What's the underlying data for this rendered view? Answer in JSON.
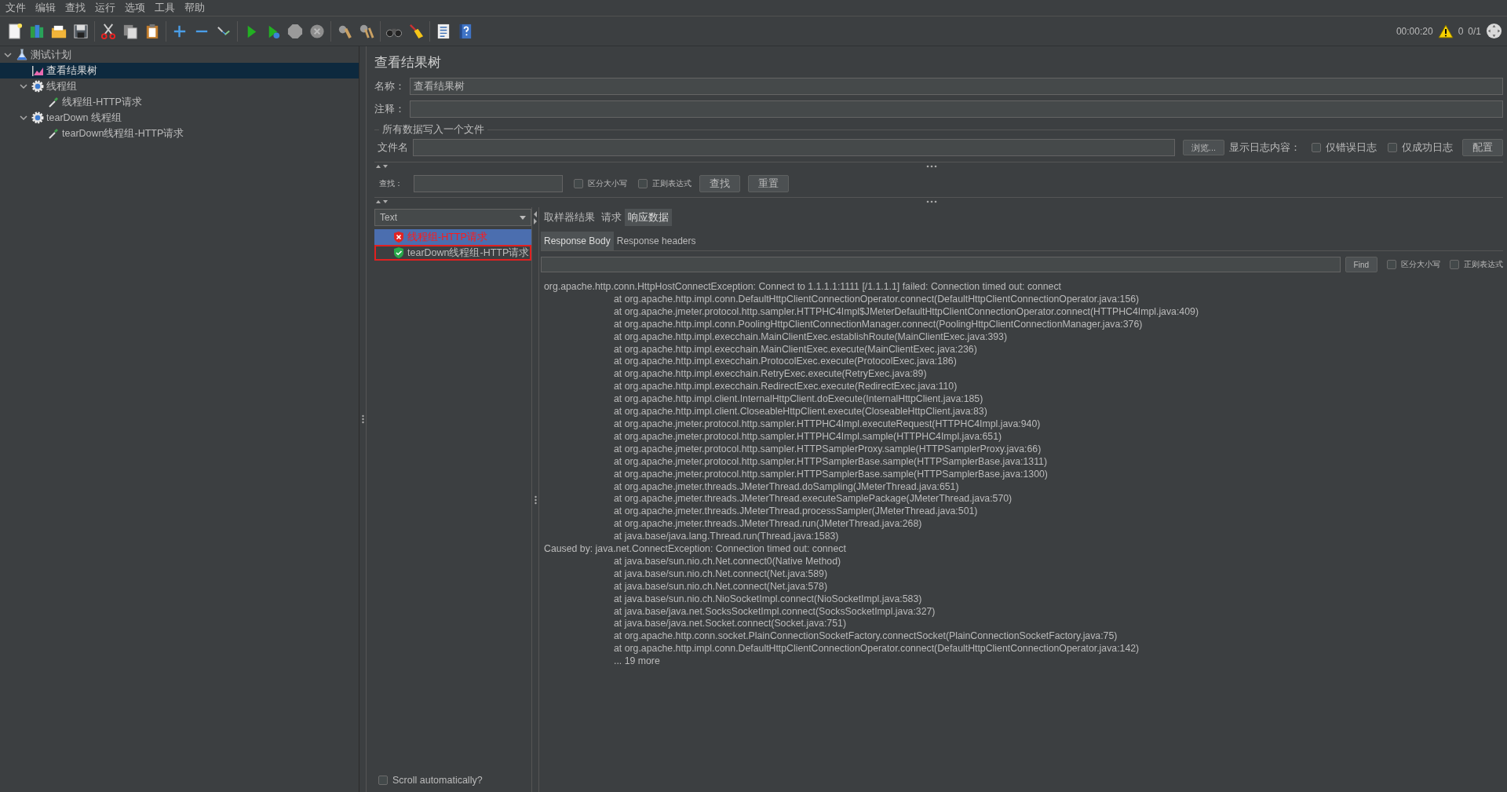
{
  "menu": [
    "文件",
    "编辑",
    "查找",
    "运行",
    "选项",
    "工具",
    "帮助"
  ],
  "status": {
    "elapsed": "00:00:20",
    "errors": "0",
    "threads": "0/1"
  },
  "tree": [
    {
      "label": "测试计划",
      "kind": "plan",
      "selected": false,
      "expanded": true,
      "children": [
        {
          "label": "查看结果树",
          "kind": "listener",
          "selected": true
        },
        {
          "label": "线程组",
          "kind": "thread_group",
          "selected": false,
          "expanded": true,
          "children": [
            {
              "label": "线程组-HTTP请求",
              "kind": "sampler",
              "selected": false
            }
          ]
        },
        {
          "label": "tearDown 线程组",
          "kind": "thread_group",
          "selected": false,
          "expanded": true,
          "children": [
            {
              "label": "tearDown线程组-HTTP请求",
              "kind": "sampler",
              "selected": false
            }
          ]
        }
      ]
    }
  ],
  "panel": {
    "title": "查看结果树",
    "name_label": "名称：",
    "name_value": "查看结果树",
    "comment_label": "注释：",
    "file_section": "所有数据写入一个文件",
    "filename_label": "文件名",
    "browse_button": "浏览...",
    "log_label": "显示日志内容：",
    "log_options": [
      {
        "label": "仅错误日志",
        "checked": false
      },
      {
        "label": "仅成功日志",
        "checked": false
      }
    ],
    "configure_button": "配置"
  },
  "search": {
    "label": "查找：",
    "options": [
      {
        "label": "区分大小写",
        "checked": false
      },
      {
        "label": "正则表达式",
        "checked": false
      }
    ],
    "find_button": "查找",
    "reset_button": "重置"
  },
  "results": {
    "renderer": "Text",
    "items": [
      {
        "label": "线程组-HTTP请求",
        "kind": "error",
        "selected": true,
        "focused": false
      },
      {
        "label": "tearDown线程组-HTTP请求",
        "kind": "success",
        "selected": false,
        "focused": true
      }
    ]
  },
  "tabs": [
    {
      "label": "取样器结果",
      "selected": false
    },
    {
      "label": "请求",
      "selected": false
    },
    {
      "label": "响应数据",
      "selected": true
    }
  ],
  "subtabs": [
    {
      "label": "Response Body",
      "selected": true
    },
    {
      "label": "Response headers",
      "selected": false
    }
  ],
  "body_search": {
    "button": "Find",
    "options": [
      {
        "label": "区分大小写",
        "checked": false
      },
      {
        "label": "正则表达式",
        "checked": false
      }
    ]
  },
  "response_lines": [
    {
      "kind": "head",
      "text": "org.apache.http.conn.HttpHostConnectException: Connect to 1.1.1.1:1111 [/1.1.1.1] failed: Connection timed out: connect"
    },
    {
      "kind": "frame",
      "text": "at org.apache.http.impl.conn.DefaultHttpClientConnectionOperator.connect(DefaultHttpClientConnectionOperator.java:156)"
    },
    {
      "kind": "frame",
      "text": "at org.apache.jmeter.protocol.http.sampler.HTTPHC4Impl$JMeterDefaultHttpClientConnectionOperator.connect(HTTPHC4Impl.java:409)"
    },
    {
      "kind": "frame",
      "text": "at org.apache.http.impl.conn.PoolingHttpClientConnectionManager.connect(PoolingHttpClientConnectionManager.java:376)"
    },
    {
      "kind": "frame",
      "text": "at org.apache.http.impl.execchain.MainClientExec.establishRoute(MainClientExec.java:393)"
    },
    {
      "kind": "frame",
      "text": "at org.apache.http.impl.execchain.MainClientExec.execute(MainClientExec.java:236)"
    },
    {
      "kind": "frame",
      "text": "at org.apache.http.impl.execchain.ProtocolExec.execute(ProtocolExec.java:186)"
    },
    {
      "kind": "frame",
      "text": "at org.apache.http.impl.execchain.RetryExec.execute(RetryExec.java:89)"
    },
    {
      "kind": "frame",
      "text": "at org.apache.http.impl.execchain.RedirectExec.execute(RedirectExec.java:110)"
    },
    {
      "kind": "frame",
      "text": "at org.apache.http.impl.client.InternalHttpClient.doExecute(InternalHttpClient.java:185)"
    },
    {
      "kind": "frame",
      "text": "at org.apache.http.impl.client.CloseableHttpClient.execute(CloseableHttpClient.java:83)"
    },
    {
      "kind": "frame",
      "text": "at org.apache.jmeter.protocol.http.sampler.HTTPHC4Impl.executeRequest(HTTPHC4Impl.java:940)"
    },
    {
      "kind": "frame",
      "text": "at org.apache.jmeter.protocol.http.sampler.HTTPHC4Impl.sample(HTTPHC4Impl.java:651)"
    },
    {
      "kind": "frame",
      "text": "at org.apache.jmeter.protocol.http.sampler.HTTPSamplerProxy.sample(HTTPSamplerProxy.java:66)"
    },
    {
      "kind": "frame",
      "text": "at org.apache.jmeter.protocol.http.sampler.HTTPSamplerBase.sample(HTTPSamplerBase.java:1311)"
    },
    {
      "kind": "frame",
      "text": "at org.apache.jmeter.protocol.http.sampler.HTTPSamplerBase.sample(HTTPSamplerBase.java:1300)"
    },
    {
      "kind": "frame",
      "text": "at org.apache.jmeter.threads.JMeterThread.doSampling(JMeterThread.java:651)"
    },
    {
      "kind": "frame",
      "text": "at org.apache.jmeter.threads.JMeterThread.executeSamplePackage(JMeterThread.java:570)"
    },
    {
      "kind": "frame",
      "text": "at org.apache.jmeter.threads.JMeterThread.processSampler(JMeterThread.java:501)"
    },
    {
      "kind": "frame",
      "text": "at org.apache.jmeter.threads.JMeterThread.run(JMeterThread.java:268)"
    },
    {
      "kind": "frame",
      "text": "at java.base/java.lang.Thread.run(Thread.java:1583)"
    },
    {
      "kind": "head",
      "text": "Caused by: java.net.ConnectException: Connection timed out: connect"
    },
    {
      "kind": "frame",
      "text": "at java.base/sun.nio.ch.Net.connect0(Native Method)"
    },
    {
      "kind": "frame",
      "text": "at java.base/sun.nio.ch.Net.connect(Net.java:589)"
    },
    {
      "kind": "frame",
      "text": "at java.base/sun.nio.ch.Net.connect(Net.java:578)"
    },
    {
      "kind": "frame",
      "text": "at java.base/sun.nio.ch.NioSocketImpl.connect(NioSocketImpl.java:583)"
    },
    {
      "kind": "frame",
      "text": "at java.base/java.net.SocksSocketImpl.connect(SocksSocketImpl.java:327)"
    },
    {
      "kind": "frame",
      "text": "at java.base/java.net.Socket.connect(Socket.java:751)"
    },
    {
      "kind": "frame",
      "text": "at org.apache.http.conn.socket.PlainConnectionSocketFactory.connectSocket(PlainConnectionSocketFactory.java:75)"
    },
    {
      "kind": "frame",
      "text": "at org.apache.http.impl.conn.DefaultHttpClientConnectionOperator.connect(DefaultHttpClientConnectionOperator.java:142)"
    },
    {
      "kind": "frame",
      "text": "... 19 more"
    }
  ],
  "scroll_auto": {
    "label": "Scroll automatically?",
    "checked": false
  }
}
